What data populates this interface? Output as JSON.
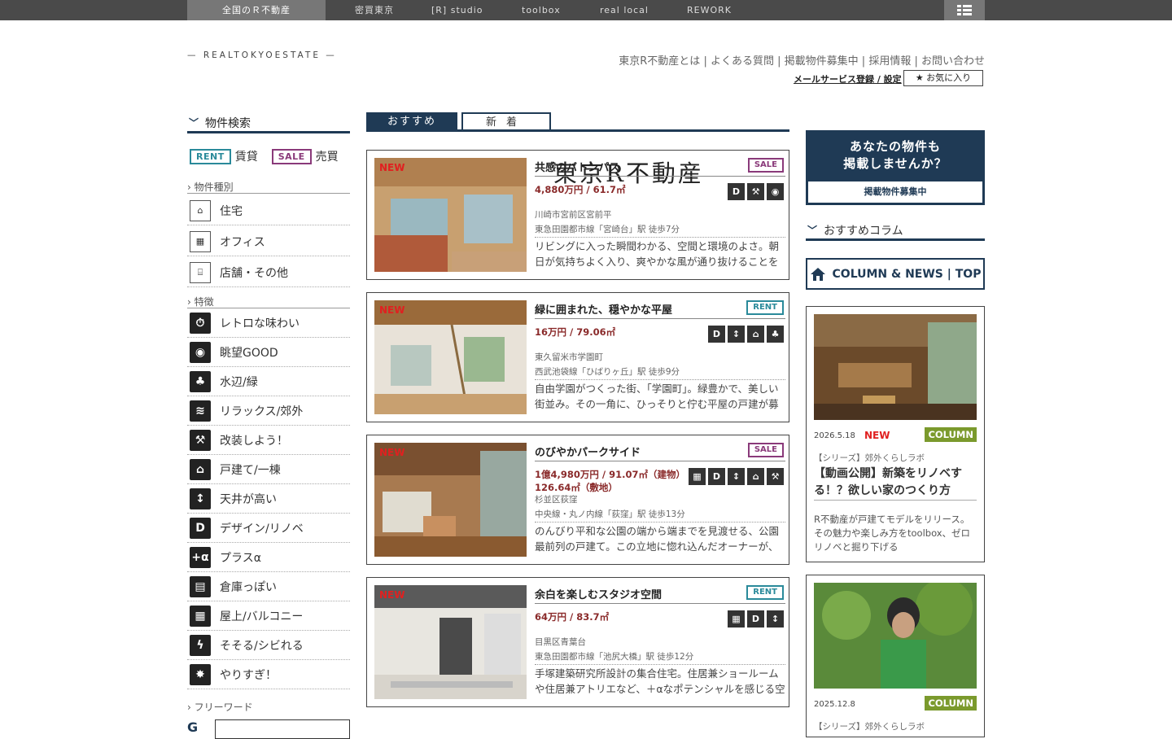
{
  "topnav": {
    "items": [
      "全国のＲ不動産",
      "密買東京",
      "[R] studio",
      "toolbox",
      "real local",
      "REWORK"
    ]
  },
  "logo": {
    "main": "東京R不動産",
    "sub": "— REALTOKYOESTATE —"
  },
  "header": {
    "links": [
      "東京R不動産とは",
      "よくある質問",
      "掲載物件募集中",
      "採用情報",
      "お問い合わせ"
    ],
    "mail": "メールサービス登録 / 設定",
    "favorite": "★ お気に入り"
  },
  "sidebar": {
    "title": "物件検索",
    "rent_badge": "RENT",
    "rent_label": "賃貸",
    "sale_badge": "SALE",
    "sale_label": "売買",
    "type_label": "物件種別",
    "types": [
      {
        "label": "住宅",
        "icon": "house-icon"
      },
      {
        "label": "オフィス",
        "icon": "office-building-icon"
      },
      {
        "label": "店舗・その他",
        "icon": "shop-etc-icon"
      }
    ],
    "feature_label": "特徴",
    "features": [
      {
        "label": "レトロな味わい",
        "icon": "retro-watch-icon",
        "g": "⏱"
      },
      {
        "label": "眺望GOOD",
        "icon": "view-eye-icon",
        "g": "◉"
      },
      {
        "label": "水辺/緑",
        "icon": "waterside-green-icon",
        "g": "♣"
      },
      {
        "label": "リラックス/郊外",
        "icon": "relax-suburb-icon",
        "g": "≋"
      },
      {
        "label": "改装しよう！",
        "icon": "renovate-drill-icon",
        "g": "⚒"
      },
      {
        "label": "戸建て/一棟",
        "icon": "detached-house-icon",
        "g": "⌂"
      },
      {
        "label": "天井が高い",
        "icon": "high-ceiling-icon",
        "g": "↕"
      },
      {
        "label": "デザイン/リノベ",
        "icon": "design-d-icon",
        "g": "D"
      },
      {
        "label": "プラスα",
        "icon": "plus-alpha-icon",
        "g": "+α"
      },
      {
        "label": "倉庫っぽい",
        "icon": "warehouse-icon",
        "g": "▤"
      },
      {
        "label": "屋上/バルコニー",
        "icon": "rooftop-balcony-icon",
        "g": "▦"
      },
      {
        "label": "そそる/シビれる",
        "icon": "thrill-lightning-icon",
        "g": "ϟ"
      },
      {
        "label": "やりすぎ！",
        "icon": "overdone-burst-icon",
        "g": "✸"
      }
    ],
    "freeword_label": "フリーワード"
  },
  "tabs": {
    "recommended": "おすすめ",
    "new": "新着"
  },
  "listings": [
    {
      "new": "NEW",
      "title": "共感のバトンパス",
      "tag": "SALE",
      "tag_color": "#8a3a7a",
      "price": "4,880万円 / 61.7㎡",
      "icons": [
        "D",
        "⚒",
        "◉"
      ],
      "addr1": "川崎市宮前区宮前平",
      "addr2": "東急田園都市線「宮崎台」駅 徒歩7分",
      "desc": "リビングに入った瞬間わかる、空間と環境のよさ。朝日が気持ちよく入り、爽やかな風が通り抜けることを容易"
    },
    {
      "new": "NEW",
      "title": "緑に囲まれた、穏やかな平屋",
      "tag": "RENT",
      "tag_color": "#2a8a9a",
      "price": "16万円 / 79.06㎡",
      "icons": [
        "D",
        "↕",
        "⌂",
        "♣"
      ],
      "addr1": "東久留米市学園町",
      "addr2": "西武池袋線「ひばりヶ丘」駅 徒歩9分",
      "desc": "自由学園がつくった街、「学園町」。緑豊かで、美しい街並み。その一角に、ひっそりと佇む平屋の戸建が募集と"
    },
    {
      "new": "NEW",
      "title": "のびやかパークサイド",
      "tag": "SALE",
      "tag_color": "#8a3a7a",
      "price": "1億4,980万円 / 91.07㎡（建物） 126.64㎡（敷地）",
      "icons": [
        "▦",
        "D",
        "↕",
        "⌂",
        "⚒"
      ],
      "addr1": "杉並区荻窪",
      "addr2": "中央線・丸ノ内線「荻窪」駅 徒歩13分",
      "desc": "のんびり平和な公園の端から端までを見渡せる、公園最前列の戸建て。この立地に惚れ込んだオーナーが、設計"
    },
    {
      "new": "NEW",
      "title": "余白を楽しむスタジオ空間",
      "tag": "RENT",
      "tag_color": "#2a8a9a",
      "price": "64万円 / 83.7㎡",
      "icons": [
        "▦",
        "D",
        "↕"
      ],
      "addr1": "目黒区青葉台",
      "addr2": "東急田園都市線「池尻大橋」駅 徒歩12分",
      "desc": "手塚建築研究所設計の集合住宅。住居兼ショールームや住居兼アトリエなど、＋αなポテンシャルを感じる空間"
    }
  ],
  "right": {
    "promo_title": "あなたの物件も\n掲載しませんか？",
    "promo_button": "掲載物件募集中",
    "column_head": "おすすめコラム",
    "column_button": "COLUMN & NEWS | TOP",
    "columns": [
      {
        "date": "2026.5.18",
        "new": "NEW",
        "tag": "COLUMN",
        "series": "【シリーズ】郊外くらしラボ",
        "title": "【動画公開】新築をリノベする！？欲しい家のつくり方",
        "desc": "R不動産が戸建てモデルをリリース。その魅力や楽しみ方をtoolbox、ゼロリノベと掘り下げる"
      },
      {
        "date": "2025.12.8",
        "tag": "COLUMN",
        "series": "【シリーズ】郊外くらしラボ"
      }
    ]
  },
  "colors": {
    "navy": "#1f3a55",
    "rent": "#2a8a9a",
    "sale": "#8a3a7a",
    "column": "#7b9a2d",
    "new": "#e02020"
  }
}
